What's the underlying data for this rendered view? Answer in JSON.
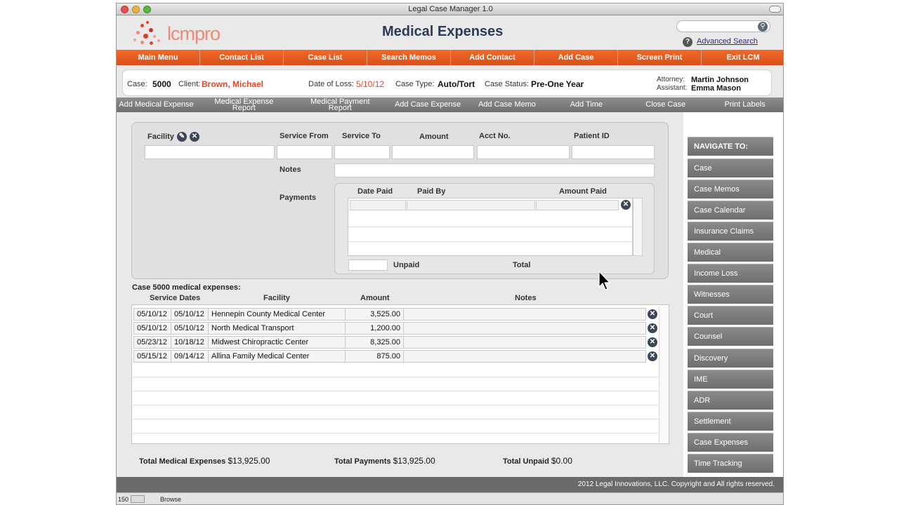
{
  "window": {
    "title": "Legal Case Manager 1.0"
  },
  "header": {
    "logo_text": "lcmpro",
    "page_title": "Medical Expenses",
    "search_placeholder": "",
    "advanced_search": "Advanced Search",
    "help_icon": "?"
  },
  "main_menu": [
    "Main Menu",
    "Contact List",
    "Case List",
    "Search Memos",
    "Add Contact",
    "Add Case",
    "Screen Print",
    "Exit LCM"
  ],
  "case": {
    "case_label": "Case:",
    "case_value": "5000",
    "client_label": "Client:",
    "client_value": "Brown, Michael",
    "dol_label": "Date of Loss:",
    "dol_value": "5/10/12",
    "type_label": "Case Type:",
    "type_value": "Auto/Tort",
    "status_label": "Case Status:",
    "status_value": "Pre-One Year",
    "attorney_label": "Attorney:",
    "attorney_value": "Martin Johnson",
    "assistant_label": "Assistant:",
    "assistant_value": "Emma Mason"
  },
  "actions": [
    "Add Medical Expense",
    "Medical Expense Report",
    "Medical Payment Report",
    "Add Case Expense",
    "Add Case Memo",
    "Add Time",
    "Close Case",
    "Print Labels"
  ],
  "entry_form": {
    "facility_label": "Facility",
    "service_from_label": "Service From",
    "service_to_label": "Service To",
    "amount_label": "Amount",
    "acct_label": "Acct No.",
    "patient_label": "Patient ID",
    "notes_label": "Notes",
    "payments_label": "Payments",
    "date_paid_label": "Date Paid",
    "paid_by_label": "Paid By",
    "amount_paid_label": "Amount Paid",
    "unpaid_label": "Unpaid",
    "total_label": "Total"
  },
  "expenses": {
    "caption": "Case 5000 medical expenses:",
    "headers": {
      "service_dates": "Service Dates",
      "facility": "Facility",
      "amount": "Amount",
      "notes": "Notes"
    },
    "rows": [
      {
        "from": "05/10/12",
        "to": "05/10/12",
        "facility": "Hennepin County Medical Center",
        "amount": "3,525.00",
        "notes": ""
      },
      {
        "from": "05/10/12",
        "to": "05/10/12",
        "facility": "North Medical Transport",
        "amount": "1,200.00",
        "notes": ""
      },
      {
        "from": "05/23/12",
        "to": "10/18/12",
        "facility": "Midwest Chiropractic Center",
        "amount": "8,325.00",
        "notes": ""
      },
      {
        "from": "05/15/12",
        "to": "09/14/12",
        "facility": "Allina Family Medical Center",
        "amount": "875.00",
        "notes": ""
      }
    ]
  },
  "totals": {
    "medical_label": "Total Medical Expenses",
    "medical_value": "$13,925.00",
    "payments_label": "Total Payments",
    "payments_value": "$13,925.00",
    "unpaid_label": "Total Unpaid",
    "unpaid_value": "$0.00"
  },
  "navigate": {
    "heading": "NAVIGATE TO:",
    "items": [
      "Case",
      "Case Memos",
      "Case Calendar",
      "Insurance Claims",
      "Medical",
      "Income Loss",
      "Witnesses",
      "Court",
      "Counsel",
      "Discovery",
      "IME",
      "ADR",
      "Settlement",
      "Case Expenses",
      "Time Tracking"
    ]
  },
  "footer": {
    "copyright": "2012 Legal Innovations, LLC. Copyright and All rights reserved."
  },
  "statusbar": {
    "zoom": "150",
    "mode": "Browse"
  },
  "colors": {
    "menu_orange": "#e85a22",
    "client_red": "#e2462a",
    "title_navy": "#2d3b58",
    "nav_gray": "#7c7c7c"
  }
}
